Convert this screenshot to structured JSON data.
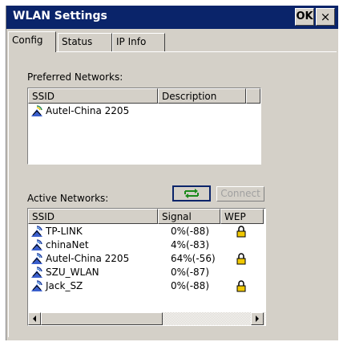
{
  "window": {
    "title": "WLAN Settings",
    "ok_label": "OK",
    "close_label": "×"
  },
  "tabs": [
    {
      "label": "Config",
      "selected": true
    },
    {
      "label": "Status",
      "selected": false
    },
    {
      "label": "IP Info",
      "selected": false
    }
  ],
  "preferred": {
    "label": "Preferred Networks:",
    "columns": [
      "SSID",
      "Description"
    ],
    "rows": [
      {
        "ssid": "Autel-China 2205",
        "description": ""
      }
    ]
  },
  "active": {
    "label": "Active Networks:",
    "refresh_icon": "refresh-arrows-icon",
    "connect_label": "Connect",
    "columns": [
      "SSID",
      "Signal",
      "WEP"
    ],
    "rows": [
      {
        "ssid": "TP-LINK",
        "signal": "0%(-88)",
        "wep": true
      },
      {
        "ssid": "chinaNet",
        "signal": "4%(-83)",
        "wep": false
      },
      {
        "ssid": "Autel-China 2205",
        "signal": "64%(-56)",
        "wep": true
      },
      {
        "ssid": "SZU_WLAN",
        "signal": "0%(-87)",
        "wep": false
      },
      {
        "ssid": "Jack_SZ",
        "signal": "0%(-88)",
        "wep": true
      }
    ]
  },
  "colors": {
    "titlebar": "#0a246a",
    "face": "#d4d0c8",
    "lock": "#f0c800"
  }
}
